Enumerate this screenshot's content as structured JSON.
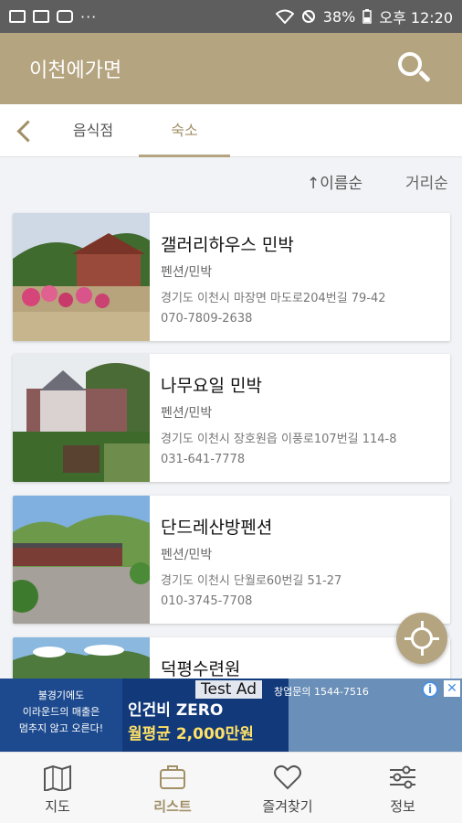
{
  "status_bar": {
    "battery": "38%",
    "time": "오후 12:20",
    "notification_icons": [
      "image-icon",
      "gallery-icon",
      "youtube-icon",
      "more-dots-icon"
    ],
    "system_icons": [
      "wifi-icon",
      "mute-icon",
      "battery-icon"
    ],
    "dots": "···"
  },
  "app_bar": {
    "title": "이천에가면",
    "background_color": "#b4a47f",
    "search_icon": "search-icon"
  },
  "tabs": {
    "back_icon": "chevron-left-icon",
    "items": [
      {
        "label": "음식점",
        "active": false
      },
      {
        "label": "숙소",
        "active": true
      }
    ],
    "active_color": "#a18f66"
  },
  "sort": {
    "name_label": "이름순",
    "name_icon": "arrow-up-icon",
    "distance_label": "거리순"
  },
  "listings": [
    {
      "name": "갤러리하우스 민박",
      "category": "펜션/민박",
      "address": "경기도 이천시 마장면 마도로204번길 79-42",
      "phone": "070-7809-2638"
    },
    {
      "name": "나무요일 민박",
      "category": "펜션/민박",
      "address": "경기도 이천시 장호원읍 이풍로107번길 114-8",
      "phone": "031-641-7778"
    },
    {
      "name": "단드레산방펜션",
      "category": "펜션/민박",
      "address": "경기도 이천시 단월로60번길 51-27",
      "phone": "010-3745-7708"
    },
    {
      "name": "덕평수련원",
      "category": "",
      "address": "",
      "phone": ""
    }
  ],
  "fab": {
    "icon": "my-location-icon"
  },
  "ad": {
    "left_line1": "불경기에도",
    "left_line2": "이라운드의 매출은",
    "left_line3": "멈추지 않고 오른다!",
    "test_label": "Test Ad",
    "headline": "인건비 ZERO",
    "average": "월평균 2,000만원",
    "phone": "창업문의 1544-7516",
    "info_icon": "info-icon",
    "close_icon": "close-icon",
    "info_text": "i",
    "close_text": "✕"
  },
  "bottom_nav": {
    "items": [
      {
        "label": "지도",
        "icon": "map-icon",
        "active": false
      },
      {
        "label": "리스트",
        "icon": "list-icon",
        "active": true
      },
      {
        "label": "즐겨찾기",
        "icon": "heart-icon",
        "active": false
      },
      {
        "label": "정보",
        "icon": "settings-sliders-icon",
        "active": false
      }
    ]
  }
}
